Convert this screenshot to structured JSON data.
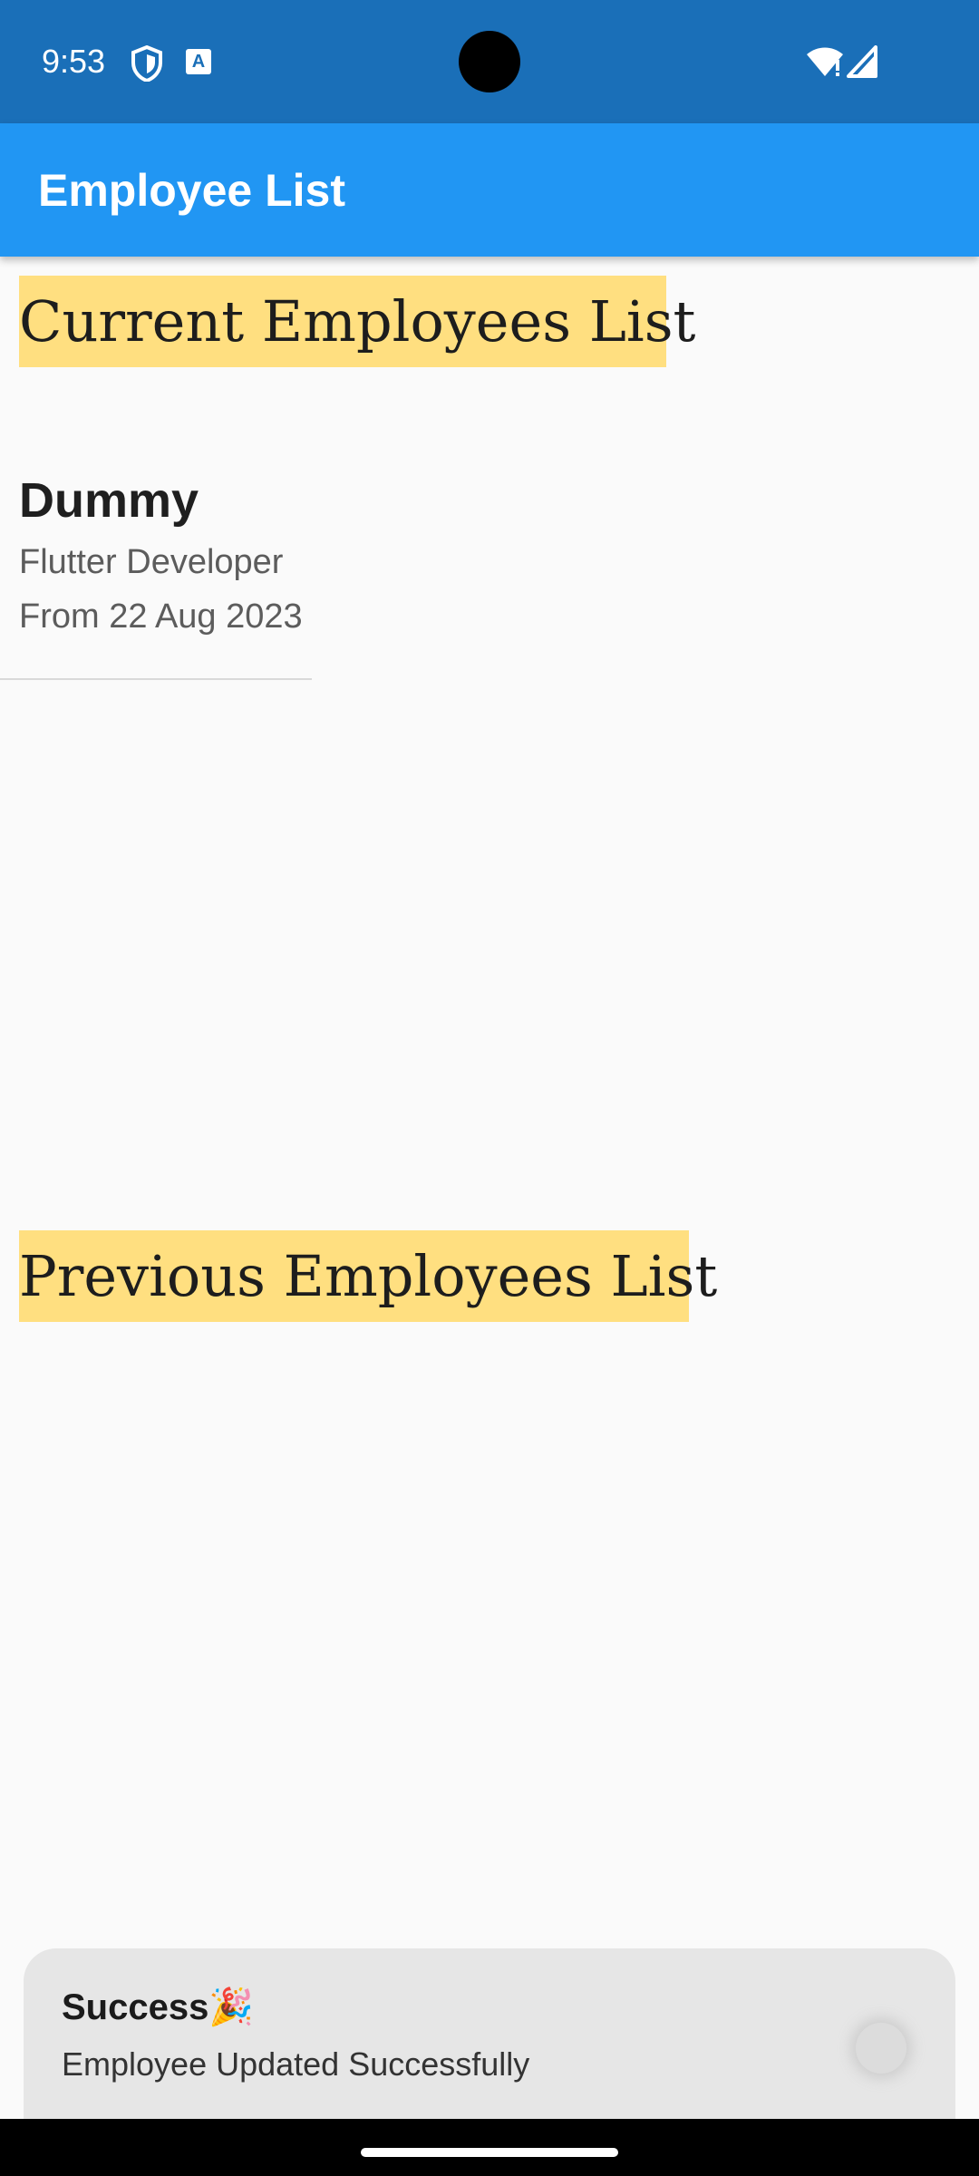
{
  "status_bar": {
    "time": "9:53",
    "icons": [
      "shield-icon",
      "translate-a-icon",
      "wifi-icon",
      "signal-icon"
    ],
    "a_glyph": "A",
    "background_color": "#1a6fb8"
  },
  "app_bar": {
    "title": "Employee List",
    "background_color": "#2196f3"
  },
  "sections": {
    "current_title": "Current Employees List",
    "previous_title": "Previous Employees List",
    "highlight_color": "#ffdf80"
  },
  "employees": [
    {
      "name": "Dummy",
      "role": "Flutter Developer",
      "from": "From 22 Aug 2023"
    }
  ],
  "snackbar": {
    "title": "Success🎉",
    "message": "Employee Updated Successfully"
  }
}
